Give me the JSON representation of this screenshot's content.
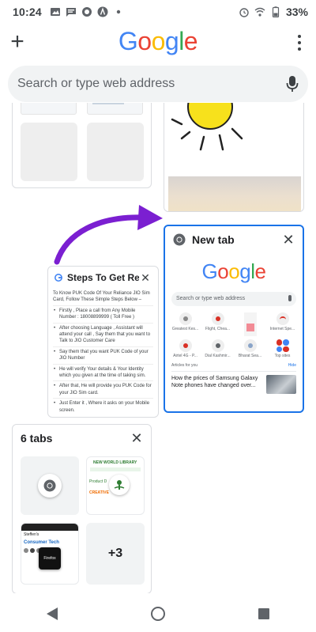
{
  "status_bar": {
    "time": "10:24",
    "battery": "33%",
    "icons": [
      "image-icon",
      "message-icon",
      "circle-icon",
      "circle-a-icon",
      "dot-icon",
      "alarm-icon",
      "wifi-icon",
      "battery-icon"
    ]
  },
  "toolbar": {
    "new_tab_label": "+",
    "logo_letters": [
      "G",
      "o",
      "o",
      "g",
      "l",
      "e"
    ],
    "logo_colors": [
      "#4285F4",
      "#EA4335",
      "#FBBC05",
      "#4285F4",
      "#34A853",
      "#EA4335"
    ]
  },
  "search": {
    "placeholder": "Search or type web address"
  },
  "tabs": {
    "new_tab": {
      "title": "New tab",
      "logo": "Google",
      "search_placeholder": "Search or type web address",
      "tiles": [
        "Greatest Kes...",
        "Flight, Chea...",
        "",
        "Internet Spe...",
        "Airtel 4G - P...",
        "Dial Kashmir...",
        "Bharat Sea...",
        "Top sites"
      ],
      "articles_label": "Articles for you",
      "hide_label": "Hide",
      "article_text": "How the prices of Samsung Galaxy Note phones have changed over..."
    },
    "jio_tab": {
      "title": "Steps To Get Relia",
      "intro": "To Know PUK Code Of Your Reliance JIO Sim Card, Follow These Simple Steps Below –",
      "steps": [
        "Firstly , Place a call from Any Mobile Number : 18008899999 ( Toll Free )",
        "After choosing Language , Assistant will attend your call , Say them that you want to Talk to JIO Customer Care",
        "Say them that you want PUK Code of your JIO Number",
        "He will verify Your details & Your Identity which you given at the time of taking sim.",
        "After that, He will provide you PUK Code for your JIO Sim card.",
        "Just Enter it , Where it asks on your Mobile screen."
      ]
    },
    "group_tab": {
      "title": "6 tabs",
      "more_count": "+3",
      "thumb_texts": [
        "NEW WORLD LIBRARY",
        "Product D",
        "CREATIVE",
        "Steffen's",
        "Consumer Tech",
        "Firefox"
      ]
    }
  },
  "colors": {
    "accent": "#1a73e8",
    "arrow": "#7b1fd1"
  }
}
